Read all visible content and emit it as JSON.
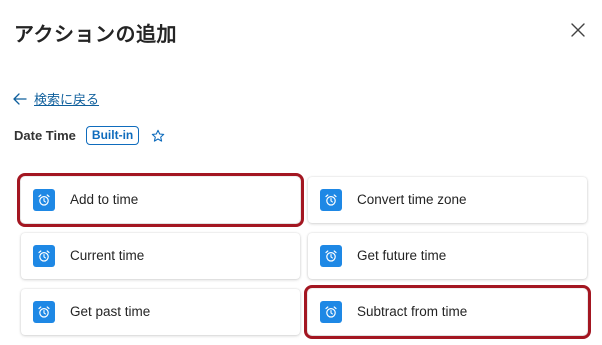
{
  "dialog": {
    "title": "アクションの追加",
    "close_icon": "close-icon"
  },
  "back_link": {
    "label": "検索に戻る",
    "icon": "arrow-left-icon"
  },
  "connector": {
    "name": "Date Time",
    "badge": "Built-in",
    "favorite_icon": "star-outline-icon"
  },
  "actions": [
    {
      "label": "Add to time",
      "icon": "alarm-clock-icon",
      "highlighted": true
    },
    {
      "label": "Convert time zone",
      "icon": "alarm-clock-icon",
      "highlighted": false
    },
    {
      "label": "Current time",
      "icon": "alarm-clock-icon",
      "highlighted": false
    },
    {
      "label": "Get future time",
      "icon": "alarm-clock-icon",
      "highlighted": false
    },
    {
      "label": "Get past time",
      "icon": "alarm-clock-icon",
      "highlighted": false
    },
    {
      "label": "Subtract from time",
      "icon": "alarm-clock-icon",
      "highlighted": true
    }
  ],
  "colors": {
    "accent": "#0f6cbd",
    "icon_background": "#1e88e5",
    "highlight_border": "#a31621",
    "link": "#0f5f9c"
  }
}
